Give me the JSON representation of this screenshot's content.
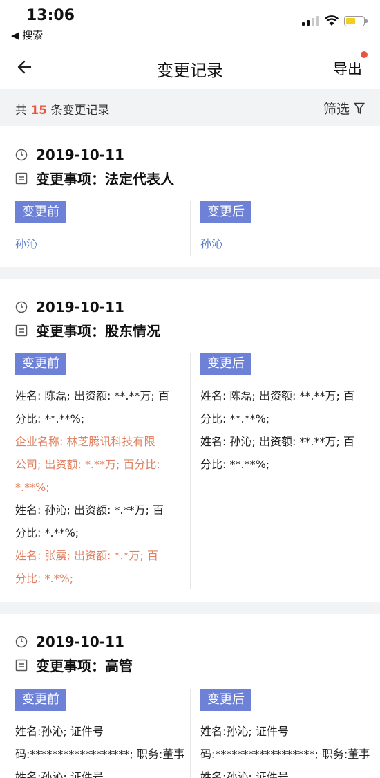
{
  "status": {
    "time": "13:06",
    "back_label": "◀ 搜索"
  },
  "nav": {
    "title": "变更记录",
    "export_label": "导出"
  },
  "summary": {
    "prefix": "共",
    "count": "15",
    "suffix": "条变更记录",
    "filter_label": "筛选"
  },
  "labels": {
    "before": "变更前",
    "after": "变更后"
  },
  "colors": {
    "accent_tag": "#6d81d6",
    "highlight": "#e08060",
    "link": "#5b7fc9",
    "badge": "#e9563f"
  },
  "records": [
    {
      "date": "2019-10-11",
      "item": "变更事项：法定代表人",
      "before": [
        {
          "text": "孙沁",
          "style": "link"
        }
      ],
      "after": [
        {
          "text": "孙沁",
          "style": "link"
        }
      ]
    },
    {
      "date": "2019-10-11",
      "item": "变更事项：股东情况",
      "before": [
        {
          "text": "姓名: 陈磊; 出资额: **.**万; 百",
          "style": "normal"
        },
        {
          "text": "分比: **.**%;",
          "style": "normal"
        },
        {
          "text": "企业名称: 林芝腾讯科技有限",
          "style": "hl"
        },
        {
          "text": "公司; 出资额: *.**万; 百分比:",
          "style": "hl"
        },
        {
          "text": "*.**%;",
          "style": "hl"
        },
        {
          "text": "姓名: 孙沁; 出资额: *.**万; 百",
          "style": "normal"
        },
        {
          "text": "分比: *.**%;",
          "style": "normal"
        },
        {
          "text": "姓名: 张震; 出资额: *.*万; 百",
          "style": "hl"
        },
        {
          "text": "分比: *.*%;",
          "style": "hl"
        }
      ],
      "after": [
        {
          "text": "姓名: 陈磊; 出资额: **.**万; 百",
          "style": "normal"
        },
        {
          "text": "分比: **.**%;",
          "style": "normal"
        },
        {
          "text": "姓名: 孙沁; 出资额: **.**万; 百",
          "style": "normal"
        },
        {
          "text": "分比: **.**%;",
          "style": "normal"
        }
      ]
    },
    {
      "date": "2019-10-11",
      "item": "变更事项：高管",
      "before": [
        {
          "text": "姓名:孙沁; 证件号",
          "style": "normal"
        },
        {
          "text": "码:******************; 职务:董事",
          "style": "normal"
        },
        {
          "text": "姓名:孙沁; 证件号",
          "style": "normal"
        }
      ],
      "after": [
        {
          "text": "姓名:孙沁; 证件号",
          "style": "normal"
        },
        {
          "text": "码:******************; 职务:董事",
          "style": "normal"
        },
        {
          "text": "姓名:孙沁; 证件号",
          "style": "normal"
        }
      ]
    }
  ]
}
